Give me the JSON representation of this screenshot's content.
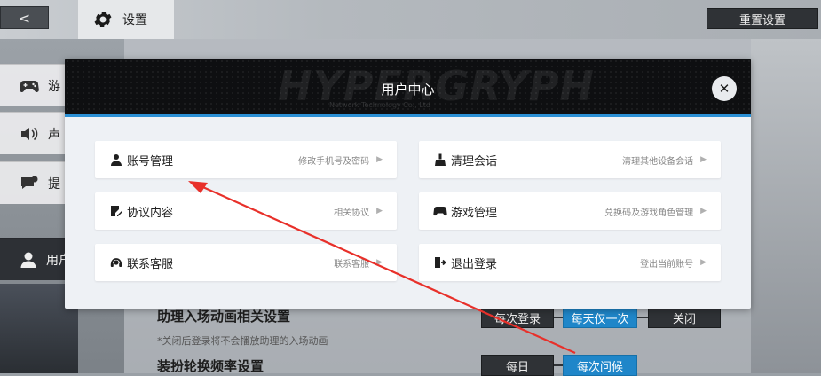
{
  "header": {
    "back_glyph": "<",
    "title": "设置",
    "reset_label": "重置设置"
  },
  "sidebar": {
    "items": [
      {
        "label": "游",
        "icon": "gamepad-icon"
      },
      {
        "label": "声",
        "icon": "speaker-icon"
      },
      {
        "label": "提",
        "icon": "message-icon"
      },
      {
        "label": "用户",
        "icon": "user-icon",
        "active": true
      }
    ]
  },
  "underlying": {
    "row1_title": "助理入场动画相关设置",
    "row1_hint": "*关闭后登录将不会播放助理的入场动画",
    "row1_options": [
      "每次登录",
      "每天仅一次",
      "关闭"
    ],
    "row1_selected": 1,
    "row2_title": "装扮轮换频率设置",
    "row2_options": [
      "每日",
      "每次问候"
    ],
    "row2_selected": 1
  },
  "modal": {
    "title": "用户中心",
    "close_glyph": "✕",
    "watermark": "HYPERGRYPH",
    "watermark_sub": "Network Technology Co., Ltd",
    "cards": [
      {
        "label": "账号管理",
        "desc": "修改手机号及密码",
        "icon": "user-icon"
      },
      {
        "label": "清理会话",
        "desc": "清理其他设备会话",
        "icon": "broom-icon"
      },
      {
        "label": "协议内容",
        "desc": "相关协议",
        "icon": "document-edit-icon"
      },
      {
        "label": "游戏管理",
        "desc": "兑换码及游戏角色管理",
        "icon": "gamepad-icon"
      },
      {
        "label": "联系客服",
        "desc": "联系客服",
        "icon": "headset-icon"
      },
      {
        "label": "退出登录",
        "desc": "登出当前账号",
        "icon": "logout-icon"
      }
    ],
    "arrow_glyph": "▶"
  },
  "annotation": {
    "arrow_color": "#e8302a"
  }
}
